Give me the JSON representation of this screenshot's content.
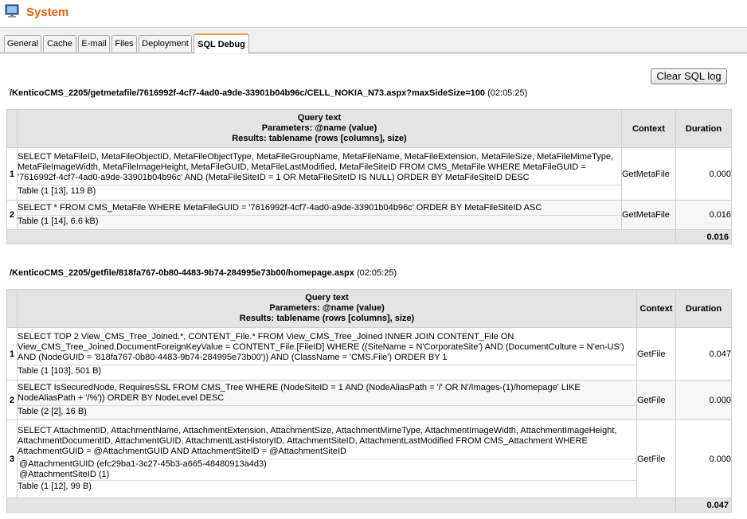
{
  "header": {
    "title": "System",
    "icon": "computer-monitor-icon"
  },
  "tabs": [
    {
      "label": "General"
    },
    {
      "label": "Cache"
    },
    {
      "label": "E-mail"
    },
    {
      "label": "Files"
    },
    {
      "label": "Deployment"
    },
    {
      "label": "SQL Debug"
    }
  ],
  "active_tab": "SQL Debug",
  "clear_button": "Clear SQL log",
  "header_labels": {
    "query_text": "Query text",
    "parameters": "Parameters: @name (value)",
    "results": "Results: tablename (rows [columns], size)",
    "context": "Context",
    "duration": "Duration"
  },
  "requests": [
    {
      "url": "/KenticoCMS_2205/getmetafile/7616992f-4cf7-4ad0-a9de-33901b04b96c/CELL_NOKIA_N73.aspx?maxSideSize=100",
      "time": "(02:05:25)",
      "queries": [
        {
          "num": "1",
          "text": "SELECT MetaFileID, MetaFileObjectID, MetaFileObjectType, MetaFileGroupName, MetaFileName, MetaFileExtension, MetaFileSize, MetaFileMimeType, MetaFileImageWidth, MetaFileImageHeight, MetaFileGUID, MetaFileLastModified, MetaFileSiteID FROM CMS_MetaFile WHERE MetaFileGUID = '7616992f-4cf7-4ad0-a9de-33901b04b96c' AND (MetaFileSiteID = 1 OR MetaFileSiteID IS NULL) ORDER BY MetaFileSiteID DESC",
          "params": [],
          "result": "Table (1 [13], 119 B)",
          "context": "GetMetaFile",
          "duration": "0.000"
        },
        {
          "num": "2",
          "text": "SELECT * FROM CMS_MetaFile WHERE MetaFileGUID = '7616992f-4cf7-4ad0-a9de-33901b04b96c' ORDER BY MetaFileSiteID ASC",
          "params": [],
          "result": "Table (1 [14], 6.6 kB)",
          "context": "GetMetaFile",
          "duration": "0.016"
        }
      ],
      "total": "0.016"
    },
    {
      "url": "/KenticoCMS_2205/getfile/818fa767-0b80-4483-9b74-284995e73b00/homepage.aspx",
      "time": "(02:05:25)",
      "queries": [
        {
          "num": "1",
          "text": "SELECT TOP 2 View_CMS_Tree_Joined.*, CONTENT_File.* FROM View_CMS_Tree_Joined INNER JOIN CONTENT_File ON View_CMS_Tree_Joined.DocumentForeignKeyValue = CONTENT_File.[FileID] WHERE ((SiteName = N'CorporateSite') AND (DocumentCulture = N'en-US') AND (NodeGUID = '818fa767-0b80-4483-9b74-284995e73b00')) AND (ClassName = 'CMS.File') ORDER BY 1",
          "params": [],
          "result": "Table (1 [103], 501 B)",
          "context": "GetFile",
          "duration": "0.047"
        },
        {
          "num": "2",
          "text": "SELECT IsSecuredNode, RequiresSSL FROM CMS_Tree WHERE (NodeSiteID = 1 AND (NodeAliasPath = '/' OR N'/Images-(1)/homepage' LIKE NodeAliasPath + '/%')) ORDER BY NodeLevel DESC",
          "params": [],
          "result": "Table (2 [2], 16 B)",
          "context": "GetFile",
          "duration": "0.000"
        },
        {
          "num": "3",
          "text": "SELECT AttachmentID, AttachmentName, AttachmentExtension, AttachmentSize, AttachmentMimeType, AttachmentImageWidth, AttachmentImageHeight, AttachmentDocumentID, AttachmentGUID, AttachmentLastHistoryID, AttachmentSiteID, AttachmentLastModified FROM CMS_Attachment WHERE AttachmentGUID = @AttachmentGUID AND AttachmentSiteID = @AttachmentSiteID",
          "params": [
            "@AttachmentGUID (efc29ba1-3c27-45b3-a665-48480913a4d3)",
            "@AttachmentSiteID (1)"
          ],
          "result": "Table (1 [12], 99 B)",
          "context": "GetFile",
          "duration": "0.000"
        }
      ],
      "total": "0.047"
    }
  ]
}
